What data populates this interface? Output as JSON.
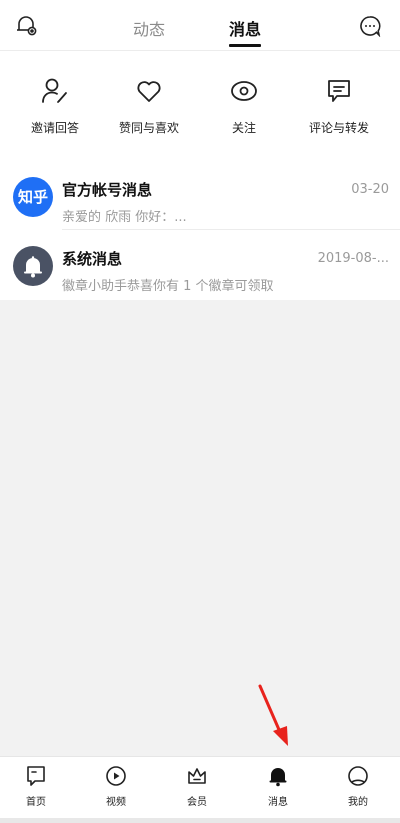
{
  "header": {
    "tabs": [
      {
        "label": "动态",
        "active": false
      },
      {
        "label": "消息",
        "active": true
      }
    ],
    "left_icon": "bell-settings-icon",
    "right_icon": "chat-bubble-icon"
  },
  "quick_actions": [
    {
      "label": "邀请回答",
      "icon": "person-pen-icon"
    },
    {
      "label": "赞同与喜欢",
      "icon": "heart-icon"
    },
    {
      "label": "关注",
      "icon": "eye-icon"
    },
    {
      "label": "评论与转发",
      "icon": "comment-icon"
    }
  ],
  "messages": [
    {
      "avatar_text": "知乎",
      "title": "官方帐号消息",
      "preview": "亲爱的 欣雨 你好：...",
      "time": "03-20"
    },
    {
      "avatar_icon": "bell-icon",
      "title": "系统消息",
      "preview": "徽章小助手恭喜你有 1 个徽章可领取",
      "time": "2019-08-..."
    }
  ],
  "bottom_nav": [
    {
      "label": "首页",
      "icon": "home-icon"
    },
    {
      "label": "视频",
      "icon": "play-icon"
    },
    {
      "label": "会员",
      "icon": "crown-icon"
    },
    {
      "label": "消息",
      "icon": "bell-icon",
      "active": true
    },
    {
      "label": "我的",
      "icon": "profile-icon"
    }
  ],
  "colors": {
    "accent": "#1f6ff5",
    "annotation_arrow": "#e8231d"
  }
}
